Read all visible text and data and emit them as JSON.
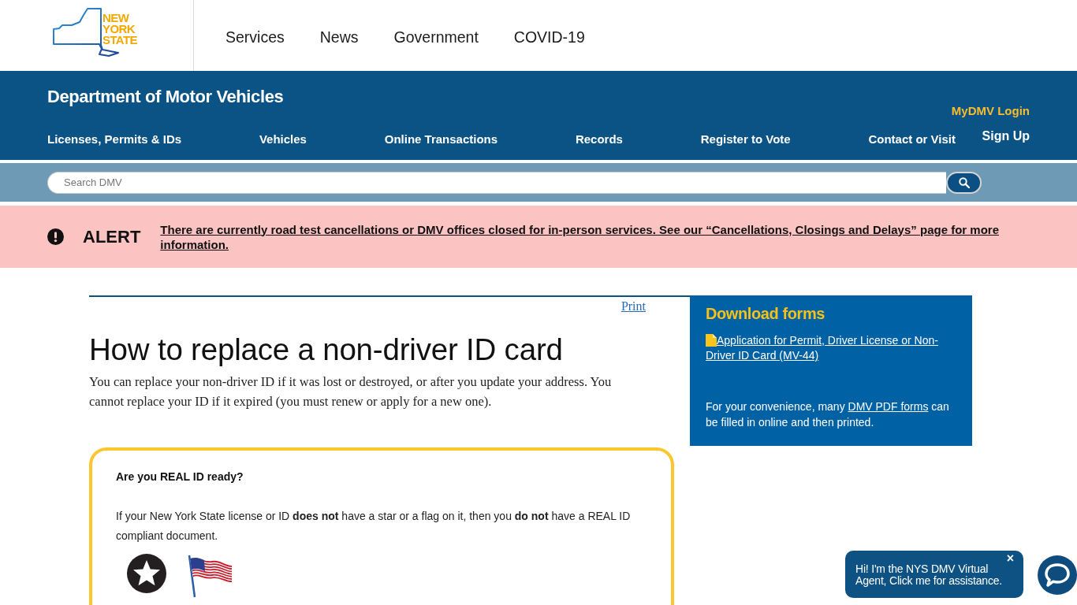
{
  "header": {
    "logo": {
      "lines": [
        "NEW",
        "YORK",
        "STATE"
      ]
    },
    "nav": [
      "Services",
      "News",
      "Government",
      "COVID-19"
    ]
  },
  "agency": {
    "title": "Department of Motor Vehicles",
    "nav": [
      "Licenses, Permits & IDs",
      "Vehicles",
      "Online Transactions",
      "Records",
      "Register to Vote",
      "Contact or Visit"
    ],
    "login": "MyDMV Login",
    "signup": "Sign Up"
  },
  "search": {
    "placeholder": "Search DMV"
  },
  "alert": {
    "label": "ALERT",
    "message": "There are currently road test cancellations or DMV offices closed for in-person services. See our “Cancellations, Closings and Delays” page for more information."
  },
  "page": {
    "print": "Print",
    "title": "How to replace a non-driver ID card",
    "intro": "You can replace your non-driver ID if it was lost or destroyed, or after you update your address. You cannot replace your ID if it expired (you must renew or apply for a new one).",
    "real_id_notice": {
      "heading": "Are you REAL ID ready?",
      "text": "If your New York State license or ID **does not** have a star or a flag on it, then you **do not** have a REAL ID compliant document."
    }
  },
  "sidebar": {
    "title": "Download forms",
    "form_link": "Application for Permit, Driver License or Non-Driver ID Card (MV-44)",
    "note": {
      "before": "For your convenience, many",
      "link": "DMV PDF forms",
      "after": "can be filled in online and then printed."
    }
  },
  "chat": {
    "message": "Hi! I'm the NYS DMV Virtual Agent, Click me for assistance.",
    "close": "×"
  }
}
